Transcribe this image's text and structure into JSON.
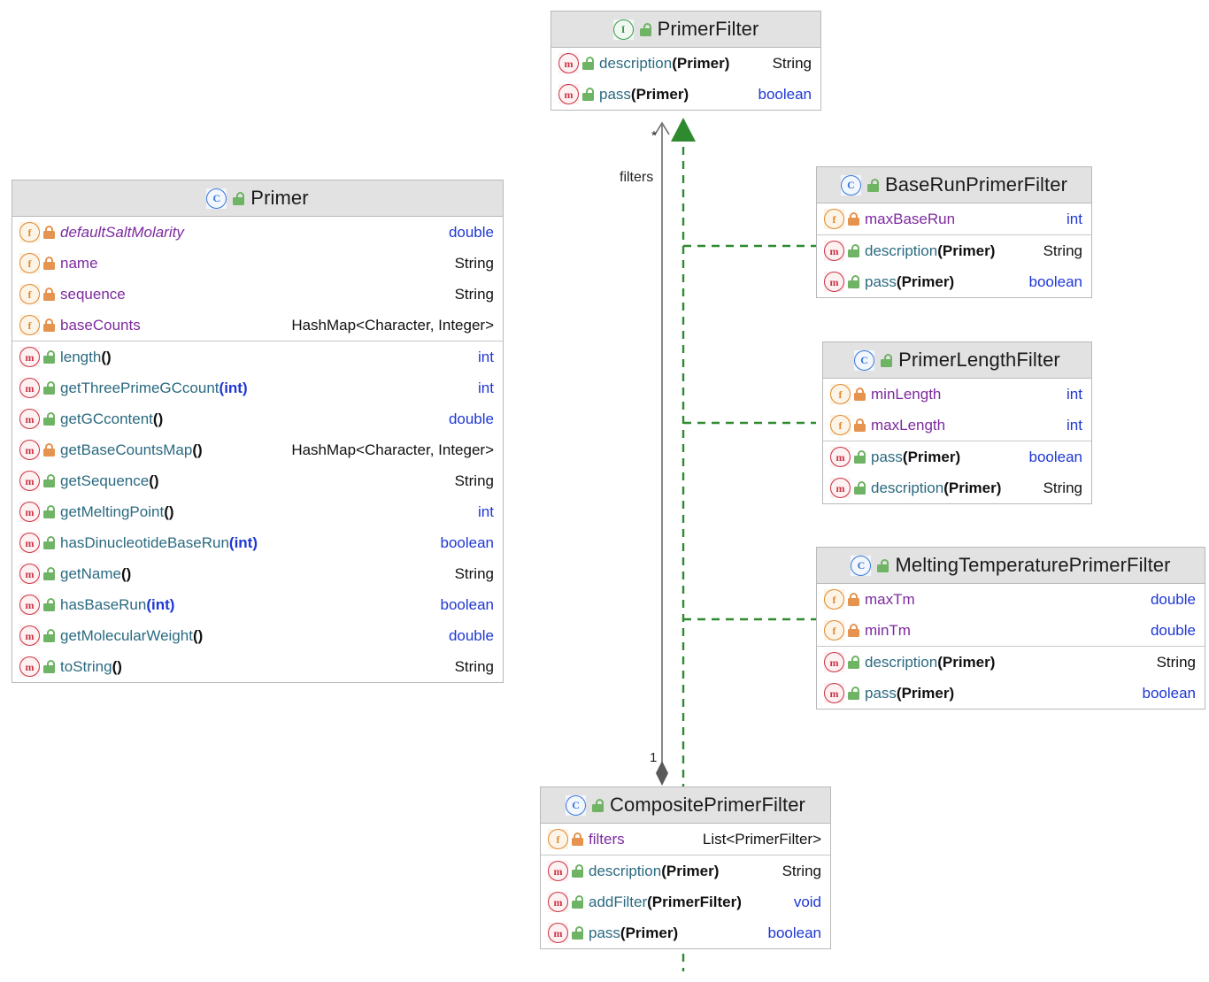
{
  "diagram": {
    "type": "uml-class-diagram",
    "colors": {
      "header_bg": "#e2e2e2",
      "border": "#b9b9b9",
      "class_icon": "#3a78d8",
      "interface_icon": "#3c9a4e",
      "field_icon": "#e08a2e",
      "method_icon": "#cc3344",
      "public_lock": "#6fb364",
      "private_lock": "#e5934f",
      "keyword_type": "#1e37d4",
      "member_name": "#7d2a9e",
      "method_name": "#2b6a80",
      "realization_edge": "#2f8a2f",
      "association_edge": "#6b6b6b"
    }
  },
  "classes": {
    "primer_filter": {
      "name": "PrimerFilter",
      "stereotype": "interface",
      "icon": "interface-icon",
      "visibility_icon": "public-lock-icon",
      "fields": [],
      "methods": [
        {
          "icon": "method-icon",
          "lock": "public-lock-icon",
          "name": "description",
          "params": "(Primer)",
          "param_kw": false,
          "type": "String",
          "type_kw": false
        },
        {
          "icon": "method-icon",
          "lock": "public-lock-icon",
          "name": "pass",
          "params": "(Primer)",
          "param_kw": false,
          "type": "boolean",
          "type_kw": true
        }
      ]
    },
    "primer": {
      "name": "Primer",
      "stereotype": "class",
      "icon": "class-icon",
      "visibility_icon": "public-lock-icon",
      "fields": [
        {
          "icon": "field-icon",
          "lock": "private-lock-icon",
          "name": "defaultSaltMolarity",
          "static": true,
          "type": "double",
          "type_kw": true
        },
        {
          "icon": "field-icon",
          "lock": "private-lock-icon",
          "name": "name",
          "static": false,
          "type": "String",
          "type_kw": false
        },
        {
          "icon": "field-icon",
          "lock": "private-lock-icon",
          "name": "sequence",
          "static": false,
          "type": "String",
          "type_kw": false
        },
        {
          "icon": "field-icon",
          "lock": "private-lock-icon",
          "name": "baseCounts",
          "static": false,
          "type": "HashMap<Character, Integer>",
          "type_kw": false
        }
      ],
      "methods": [
        {
          "icon": "method-icon",
          "lock": "public-lock-icon",
          "name": "length",
          "params": "()",
          "param_kw": false,
          "type": "int",
          "type_kw": true
        },
        {
          "icon": "method-icon",
          "lock": "public-lock-icon",
          "name": "getThreePrimeGCcount",
          "params": "(int)",
          "param_kw": true,
          "type": "int",
          "type_kw": true
        },
        {
          "icon": "method-icon",
          "lock": "public-lock-icon",
          "name": "getGCcontent",
          "params": "()",
          "param_kw": false,
          "type": "double",
          "type_kw": true
        },
        {
          "icon": "method-icon",
          "lock": "private-lock-icon",
          "name": "getBaseCountsMap",
          "params": "()",
          "param_kw": false,
          "type": "HashMap<Character, Integer>",
          "type_kw": false
        },
        {
          "icon": "method-icon",
          "lock": "public-lock-icon",
          "name": "getSequence",
          "params": "()",
          "param_kw": false,
          "type": "String",
          "type_kw": false
        },
        {
          "icon": "method-icon",
          "lock": "public-lock-icon",
          "name": "getMeltingPoint",
          "params": "()",
          "param_kw": false,
          "type": "int",
          "type_kw": true
        },
        {
          "icon": "method-icon",
          "lock": "public-lock-icon",
          "name": "hasDinucleotideBaseRun",
          "params": "(int)",
          "param_kw": true,
          "type": "boolean",
          "type_kw": true
        },
        {
          "icon": "method-icon",
          "lock": "public-lock-icon",
          "name": "getName",
          "params": "()",
          "param_kw": false,
          "type": "String",
          "type_kw": false
        },
        {
          "icon": "method-icon",
          "lock": "public-lock-icon",
          "name": "hasBaseRun",
          "params": "(int)",
          "param_kw": true,
          "type": "boolean",
          "type_kw": true
        },
        {
          "icon": "method-icon",
          "lock": "public-lock-icon",
          "name": "getMolecularWeight",
          "params": "()",
          "param_kw": false,
          "type": "double",
          "type_kw": true
        },
        {
          "icon": "method-icon",
          "lock": "public-lock-icon",
          "name": "toString",
          "params": "()",
          "param_kw": false,
          "type": "String",
          "type_kw": false
        }
      ]
    },
    "base_run_primer_filter": {
      "name": "BaseRunPrimerFilter",
      "stereotype": "class",
      "icon": "class-icon",
      "visibility_icon": "public-lock-icon",
      "fields": [
        {
          "icon": "field-icon",
          "lock": "private-lock-icon",
          "name": "maxBaseRun",
          "static": false,
          "type": "int",
          "type_kw": true
        }
      ],
      "methods": [
        {
          "icon": "method-icon",
          "lock": "public-lock-icon",
          "name": "description",
          "params": "(Primer)",
          "param_kw": false,
          "type": "String",
          "type_kw": false
        },
        {
          "icon": "method-icon",
          "lock": "public-lock-icon",
          "name": "pass",
          "params": "(Primer)",
          "param_kw": false,
          "type": "boolean",
          "type_kw": true
        }
      ]
    },
    "primer_length_filter": {
      "name": "PrimerLengthFilter",
      "stereotype": "class",
      "icon": "class-icon",
      "visibility_icon": "public-lock-icon",
      "fields": [
        {
          "icon": "field-icon",
          "lock": "private-lock-icon",
          "name": "minLength",
          "static": false,
          "type": "int",
          "type_kw": true
        },
        {
          "icon": "field-icon",
          "lock": "private-lock-icon",
          "name": "maxLength",
          "static": false,
          "type": "int",
          "type_kw": true
        }
      ],
      "methods": [
        {
          "icon": "method-icon",
          "lock": "public-lock-icon",
          "name": "pass",
          "params": "(Primer)",
          "param_kw": false,
          "type": "boolean",
          "type_kw": true
        },
        {
          "icon": "method-icon",
          "lock": "public-lock-icon",
          "name": "description",
          "params": "(Primer)",
          "param_kw": false,
          "type": "String",
          "type_kw": false
        }
      ]
    },
    "melting_temperature_primer_filter": {
      "name": "MeltingTemperaturePrimerFilter",
      "stereotype": "class",
      "icon": "class-icon",
      "visibility_icon": "public-lock-icon",
      "fields": [
        {
          "icon": "field-icon",
          "lock": "private-lock-icon",
          "name": "maxTm",
          "static": false,
          "type": "double",
          "type_kw": true
        },
        {
          "icon": "field-icon",
          "lock": "private-lock-icon",
          "name": "minTm",
          "static": false,
          "type": "double",
          "type_kw": true
        }
      ],
      "methods": [
        {
          "icon": "method-icon",
          "lock": "public-lock-icon",
          "name": "description",
          "params": "(Primer)",
          "param_kw": false,
          "type": "String",
          "type_kw": false
        },
        {
          "icon": "method-icon",
          "lock": "public-lock-icon",
          "name": "pass",
          "params": "(Primer)",
          "param_kw": false,
          "type": "boolean",
          "type_kw": true
        }
      ]
    },
    "composite_primer_filter": {
      "name": "CompositePrimerFilter",
      "stereotype": "class",
      "icon": "class-icon",
      "visibility_icon": "public-lock-icon",
      "fields": [
        {
          "icon": "field-icon",
          "lock": "private-lock-icon",
          "name": "filters",
          "static": false,
          "type": "List<PrimerFilter>",
          "type_kw": false
        }
      ],
      "methods": [
        {
          "icon": "method-icon",
          "lock": "public-lock-icon",
          "name": "description",
          "params": "(Primer)",
          "param_kw": false,
          "type": "String",
          "type_kw": false
        },
        {
          "icon": "method-icon",
          "lock": "public-lock-icon",
          "name": "addFilter",
          "params": "(PrimerFilter)",
          "param_kw": false,
          "type": "void",
          "type_kw": true
        },
        {
          "icon": "method-icon",
          "lock": "public-lock-icon",
          "name": "pass",
          "params": "(Primer)",
          "param_kw": false,
          "type": "boolean",
          "type_kw": true
        }
      ]
    }
  },
  "edges": {
    "association": {
      "label": "filters",
      "source_multiplicity": "1",
      "target_multiplicity": "*",
      "from": "CompositePrimerFilter",
      "to": "PrimerFilter",
      "kind": "composition"
    },
    "realizations": [
      {
        "from": "BaseRunPrimerFilter",
        "to": "PrimerFilter"
      },
      {
        "from": "PrimerLengthFilter",
        "to": "PrimerFilter"
      },
      {
        "from": "MeltingTemperaturePrimerFilter",
        "to": "PrimerFilter"
      },
      {
        "from": "CompositePrimerFilter",
        "to": "PrimerFilter"
      }
    ]
  }
}
